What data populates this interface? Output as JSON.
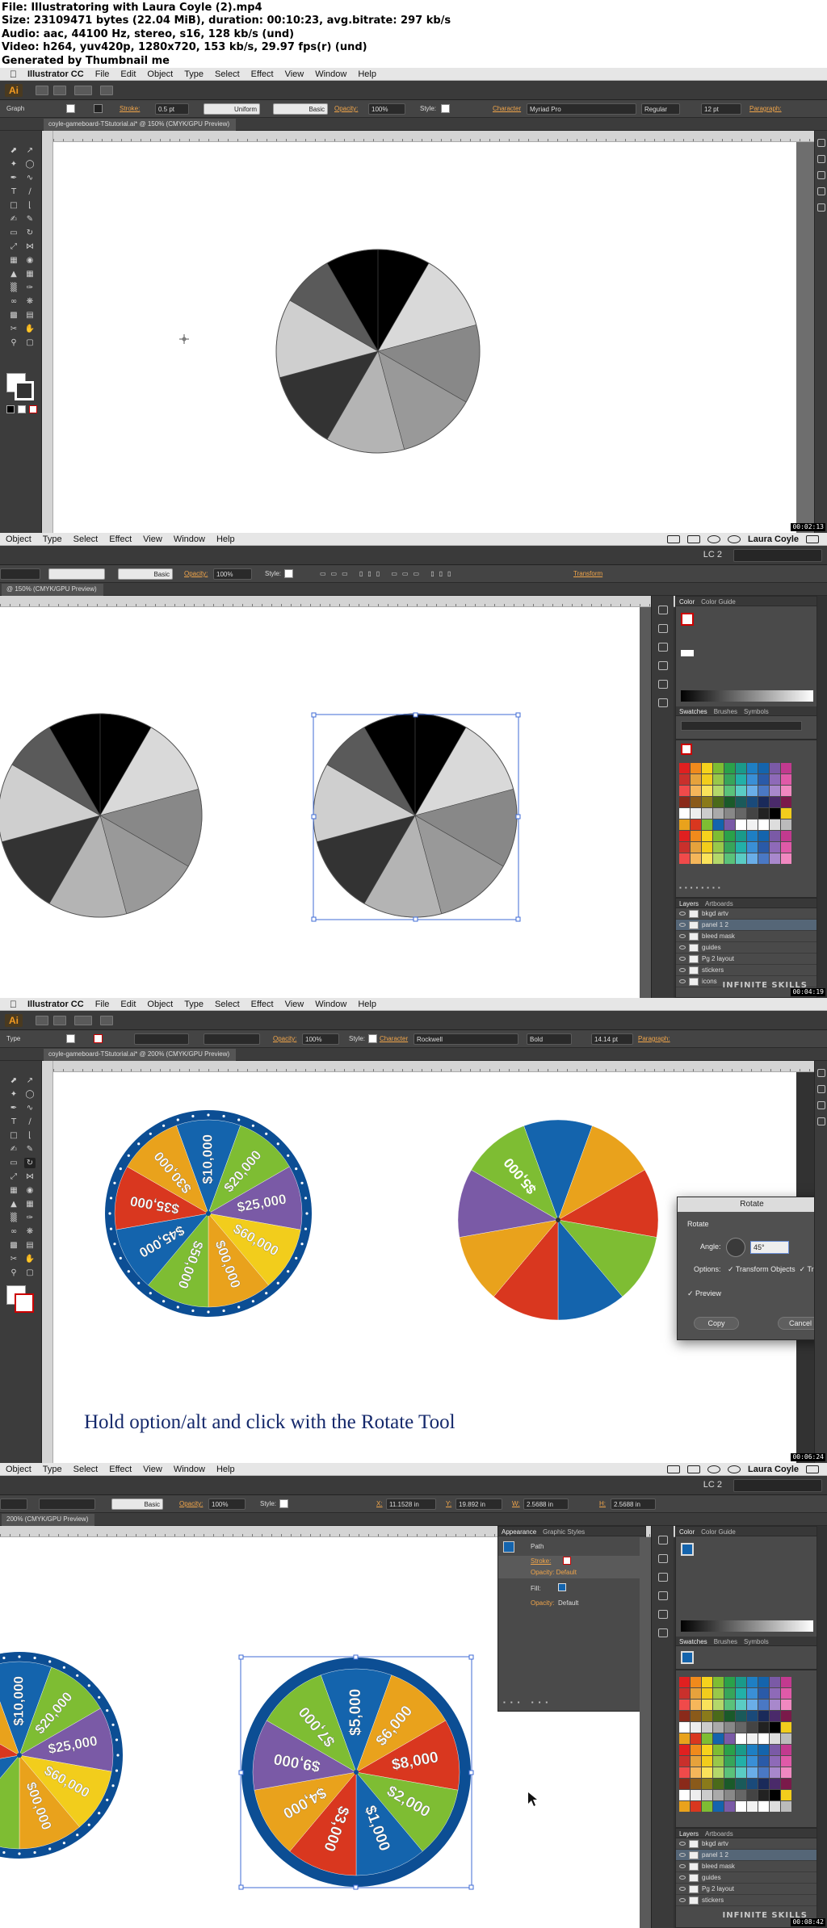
{
  "info": {
    "line1": "File: Illustratoring with Laura Coyle (2).mp4",
    "line2": "Size: 23109471 bytes (22.04 MiB), duration: 00:10:23, avg.bitrate: 297 kb/s",
    "line3": "Audio: aac, 44100 Hz, stereo, s16, 128 kb/s (und)",
    "line4": "Video: h264, yuv420p, 1280x720, 153 kb/s, 29.97 fps(r) (und)",
    "line5": "Generated by Thumbnail me"
  },
  "menu_app": {
    "app_name": "Illustrator CC",
    "items": [
      "File",
      "Edit",
      "Object",
      "Type",
      "Select",
      "Effect",
      "View",
      "Window",
      "Help"
    ]
  },
  "menu_partial": {
    "items": [
      "Object",
      "Type",
      "Select",
      "Effect",
      "View",
      "Window",
      "Help"
    ],
    "user": "Laura Coyle",
    "workspace": "LC 2"
  },
  "frame1": {
    "tool_label": "Graph",
    "stroke_label": "Stroke:",
    "stroke_value": "0.5 pt",
    "profile": "Uniform",
    "brush": "Basic",
    "opacity_label": "Opacity:",
    "opacity_value": "100%",
    "style_label": "Style:",
    "character_label": "Character",
    "font": "Myriad Pro",
    "font_style": "Regular",
    "font_size": "12 pt",
    "paragraph_label": "Paragraph:",
    "doc_tab": "coyle-gameboard-TStutorial.ai* @ 150% (CMYK/GPU Preview)",
    "timestamp": "00:02:13"
  },
  "frame2": {
    "brush": "Basic",
    "opacity_label": "Opacity:",
    "opacity_value": "100%",
    "style_label": "Style:",
    "transform_label": "Transform",
    "doc_tab": "@ 150% (CMYK/GPU Preview)",
    "panels": {
      "color_tabs": [
        "Color",
        "Color Guide"
      ],
      "swatch_tabs": [
        "Swatches",
        "Brushes",
        "Symbols"
      ],
      "layer_tabs": [
        "Layers",
        "Artboards"
      ],
      "layers": [
        "bkgd artv",
        "panel 1 2",
        "bleed mask",
        "guides",
        "Pg 2 layout",
        "stickers",
        "icons"
      ]
    },
    "timestamp": "00:04:19",
    "watermark": "INFINITE SKILLS"
  },
  "frame3": {
    "tool_label": "Type",
    "opacity_label": "Opacity:",
    "opacity_value": "100%",
    "style_label": "Style:",
    "character_label": "Character",
    "font": "Rockwell",
    "font_style": "Bold",
    "font_size": "14.14 pt",
    "paragraph_label": "Paragraph:",
    "doc_tab": "coyle-gameboard-TStutorial.ai* @ 200% (CMYK/GPU Preview)",
    "wheel_labels": [
      "$10,000",
      "$20,000",
      "$25,000",
      "$60,000",
      "$00,000",
      "$50,000",
      "$45,000",
      "$35,000",
      "$30,000"
    ],
    "right_wheel_label": "$5,000",
    "caption": "Hold option/alt and click with the Rotate Tool",
    "dialog": {
      "title": "Rotate",
      "section": "Rotate",
      "angle_label": "Angle:",
      "angle_value": "45°",
      "options_label": "Options:",
      "transform_objects": "Transform Objects",
      "transform_patterns": "Tr",
      "preview": "Preview",
      "copy": "Copy",
      "cancel": "Cancel"
    },
    "timestamp": "00:06:24"
  },
  "frame4": {
    "brush": "Basic",
    "opacity_label": "Opacity:",
    "opacity_value": "100%",
    "style_label": "Style:",
    "x_label": "X:",
    "x_value": "11.1528 in",
    "y_label": "Y:",
    "y_value": "19.892 in",
    "w_label": "W:",
    "w_value": "2.5688 in",
    "h_label": "H:",
    "h_value": "2.5688 in",
    "doc_tab": "200% (CMYK/GPU Preview)",
    "appearance": {
      "tabs": [
        "Appearance",
        "Graphic Styles"
      ],
      "path": "Path",
      "stroke": "Stroke:",
      "opacity_default": "Opacity: Default",
      "fill": "Fill:",
      "opacity": "Opacity:",
      "default": "Default"
    },
    "left_wheel_labels": [
      "$10,000",
      "$20,000",
      "$25,000",
      "$60,000",
      "$00,000"
    ],
    "right_wheel_labels": [
      "$5,000",
      "$6,000",
      "$8,000",
      "$2,000",
      "$1,000",
      "$3,000",
      "$4,000",
      "$9,000",
      "$7,000"
    ],
    "timestamp": "00:08:42",
    "watermark": "INFINITE SKILLS"
  },
  "colors": {
    "blue": "#1464ad",
    "green": "#7ebd33",
    "orange": "#e9a21c",
    "red": "#d9371f",
    "purple": "#7a5aa6",
    "yellow": "#f2cd1c",
    "darkblue": "#0c4e94",
    "navy_caption": "#14286b"
  }
}
